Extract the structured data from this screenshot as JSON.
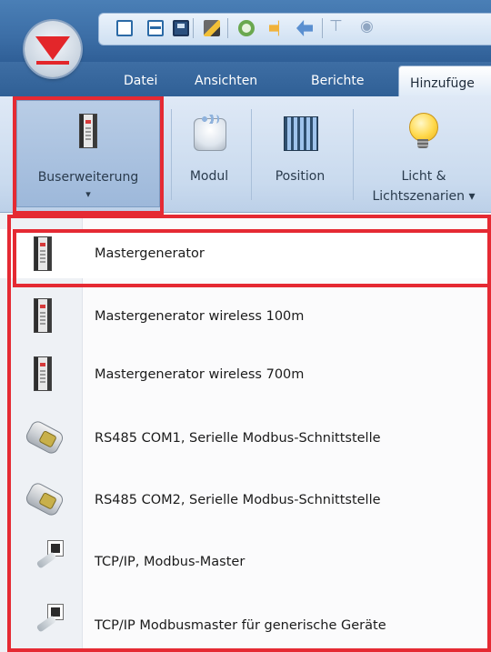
{
  "ribbon_tabs": [
    "Datei",
    "Ansichten",
    "Berichte",
    "Hinzufüge"
  ],
  "ribbon_buttons": {
    "buserweiterung": "Buserweiterung",
    "dropdown_arrow": "▾",
    "modul": "Modul",
    "position": "Position",
    "licht_line1": "Licht &",
    "licht_line2": "Lichtszenarien ▾"
  },
  "menu_items": [
    {
      "label": "Mastergenerator",
      "icon": "device-icon"
    },
    {
      "label": "Mastergenerator wireless 100m",
      "icon": "device-icon"
    },
    {
      "label": "Mastergenerator wireless 700m",
      "icon": "device-icon"
    },
    {
      "label": "RS485 COM1, Serielle Modbus-Schnittstelle",
      "icon": "serial-port-icon"
    },
    {
      "label": "RS485 COM2, Serielle Modbus-Schnittstelle",
      "icon": "serial-port-icon"
    },
    {
      "label": "TCP/IP, Modbus-Master",
      "icon": "network-plug-icon"
    },
    {
      "label": "TCP/IP Modbusmaster für generische Geräte",
      "icon": "network-plug-icon"
    }
  ],
  "colors": {
    "highlight": "#e52a33",
    "ribbon_blue": "#3c6ea6"
  }
}
